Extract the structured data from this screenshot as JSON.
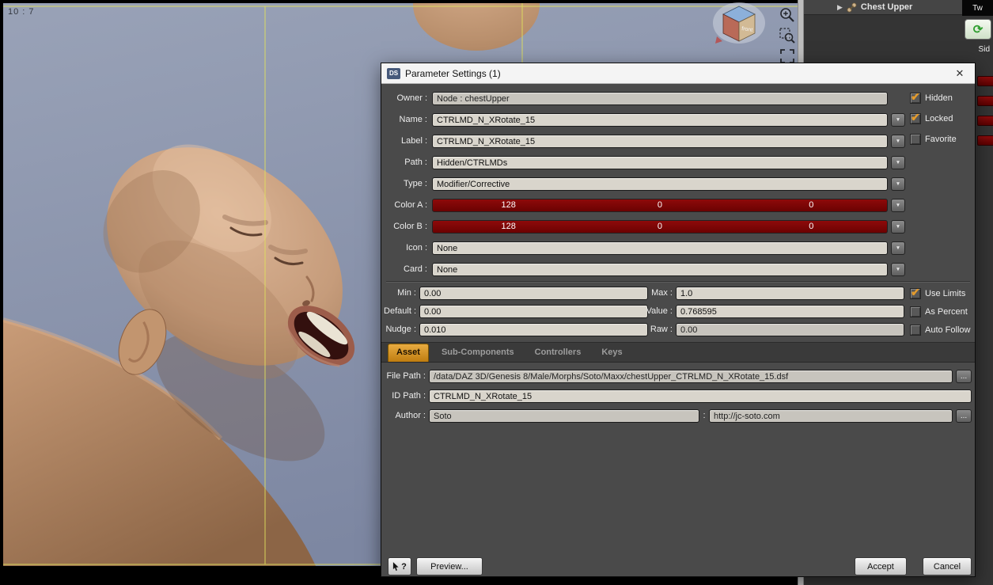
{
  "viewport": {
    "aspect_ratio_label": "10 : 7",
    "cube_front_label": "front"
  },
  "right_panel": {
    "node_label": "Chest Upper",
    "tab_top_label": "Tw",
    "tab_side_label": "Sid"
  },
  "icons": {
    "close": "✕",
    "dropdown": "▼",
    "expander": "▶",
    "sync": "⟳",
    "check": "✔",
    "help": "?",
    "browse": "..."
  },
  "dialog": {
    "title": "Parameter Settings (1)",
    "app_badge": "DS",
    "rows": {
      "owner": {
        "label": "Owner :",
        "value": "Node : chestUpper"
      },
      "name": {
        "label": "Name :",
        "value": "CTRLMD_N_XRotate_15"
      },
      "label": {
        "label": "Label :",
        "value": "CTRLMD_N_XRotate_15"
      },
      "path": {
        "label": "Path :",
        "value": "Hidden/CTRLMDs"
      },
      "type": {
        "label": "Type :",
        "value": "Modifier/Corrective"
      },
      "color_a": {
        "label": "Color A :",
        "r": "128",
        "g": "0",
        "b": "0"
      },
      "color_b": {
        "label": "Color B :",
        "r": "128",
        "g": "0",
        "b": "0"
      },
      "icon": {
        "label": "Icon :",
        "value": "None"
      },
      "card": {
        "label": "Card :",
        "value": "None"
      }
    },
    "checks": {
      "hidden": {
        "label": "Hidden",
        "checked": true
      },
      "locked": {
        "label": "Locked",
        "checked": true
      },
      "favorite": {
        "label": "Favorite",
        "checked": false
      },
      "use_limits": {
        "label": "Use Limits",
        "checked": true
      },
      "as_percent": {
        "label": "As Percent",
        "checked": false
      },
      "auto_follow": {
        "label": "Auto Follow",
        "checked": false
      }
    },
    "numeric": {
      "min": {
        "label": "Min :",
        "value": "0.00"
      },
      "max": {
        "label": "Max :",
        "value": "1.0"
      },
      "default": {
        "label": "Default :",
        "value": "0.00"
      },
      "value": {
        "label": "Value :",
        "value": "0.768595"
      },
      "nudge": {
        "label": "Nudge :",
        "value": "0.010"
      },
      "raw": {
        "label": "Raw :",
        "value": "0.00"
      }
    },
    "tabs": [
      {
        "label": "Asset"
      },
      {
        "label": "Sub-Components"
      },
      {
        "label": "Controllers"
      },
      {
        "label": "Keys"
      }
    ],
    "asset": {
      "file_path": {
        "label": "File Path :",
        "value": "/data/DAZ 3D/Genesis 8/Male/Morphs/Soto/Maxx/chestUpper_CTRLMD_N_XRotate_15.dsf"
      },
      "id_path": {
        "label": "ID Path :",
        "value": "CTRLMD_N_XRotate_15"
      },
      "author": {
        "label": "Author :",
        "name": "Soto",
        "separator": ":",
        "url": "http://jc-soto.com"
      }
    },
    "footer": {
      "preview": "Preview...",
      "accept": "Accept",
      "cancel": "Cancel"
    },
    "colors": {
      "swatch_color": "#7a0303",
      "accent_amber": "#e39b2d"
    }
  }
}
